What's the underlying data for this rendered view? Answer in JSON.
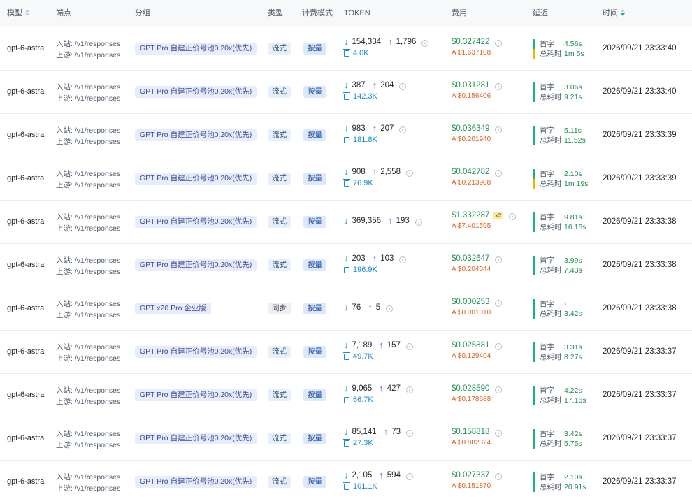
{
  "header": {
    "model": "模型",
    "endpoint": "端点",
    "group": "分组",
    "type": "类型",
    "billing": "计费模式",
    "token": "TOKEN",
    "fee": "费用",
    "latency": "延迟",
    "time": "时间"
  },
  "labels": {
    "first_token": "首字",
    "total_time": "总耗时"
  },
  "colors": {
    "fee_green": "#1f8f4e",
    "fee_alt_orange": "#e0601c",
    "cache_blue": "#1a8ad0",
    "latency_green": "#18b17a",
    "latency_yellow": "#f0b400",
    "group_bg": "#e8edfb",
    "sort_active": "#14a89b"
  },
  "icons": {
    "in": "arrow-down-icon",
    "out": "arrow-up-icon",
    "cache": "cache-icon",
    "info": "info-icon",
    "sort": "sort-icon"
  },
  "rows": [
    {
      "model": "gpt-6-astra",
      "in_ep": "入站: /v1/responses",
      "up_ep": "上游: /v1/responses",
      "group": "GPT Pro 自建正价号池0.20x(优先)",
      "type": "流式",
      "billing": "按量",
      "in_tok": "154,334",
      "out_tok": "1,796",
      "cache": "4.0K",
      "fee": "$0.327422",
      "mult": "",
      "fee_alt": "A $1.637108",
      "first": "4.56s",
      "total": "1m 5s",
      "slow": true,
      "time": "2026/09/21 23:33:40"
    },
    {
      "model": "gpt-6-astra",
      "in_ep": "入站: /v1/responses",
      "up_ep": "上游: /v1/responses",
      "group": "GPT Pro 自建正价号池0.20x(优先)",
      "type": "流式",
      "billing": "按量",
      "in_tok": "387",
      "out_tok": "204",
      "cache": "142.3K",
      "fee": "$0.031281",
      "mult": "",
      "fee_alt": "A $0.156406",
      "first": "3.06s",
      "total": "9.21s",
      "slow": false,
      "time": "2026/09/21 23:33:40"
    },
    {
      "model": "gpt-6-astra",
      "in_ep": "入站: /v1/responses",
      "up_ep": "上游: /v1/responses",
      "group": "GPT Pro 自建正价号池0.20x(优先)",
      "type": "流式",
      "billing": "按量",
      "in_tok": "983",
      "out_tok": "207",
      "cache": "181.8K",
      "fee": "$0.036349",
      "mult": "",
      "fee_alt": "A $0.201940",
      "first": "5.11s",
      "total": "11.52s",
      "slow": false,
      "time": "2026/09/21 23:33:39"
    },
    {
      "model": "gpt-6-astra",
      "in_ep": "入站: /v1/responses",
      "up_ep": "上游: /v1/responses",
      "group": "GPT Pro 自建正价号池0.20x(优先)",
      "type": "流式",
      "billing": "按量",
      "in_tok": "908",
      "out_tok": "2,558",
      "cache": "76.9K",
      "fee": "$0.042782",
      "mult": "",
      "fee_alt": "A $0.213908",
      "first": "2.10s",
      "total": "1m 19s",
      "slow": true,
      "time": "2026/09/21 23:33:39"
    },
    {
      "model": "gpt-6-astra",
      "in_ep": "入站: /v1/responses",
      "up_ep": "上游: /v1/responses",
      "group": "GPT Pro 自建正价号池0.20x(优先)",
      "type": "流式",
      "billing": "按量",
      "in_tok": "369,356",
      "out_tok": "193",
      "cache": "",
      "fee": "$1.332287",
      "mult": "x2",
      "fee_alt": "A $7.401595",
      "first": "9.81s",
      "total": "16.16s",
      "slow": false,
      "time": "2026/09/21 23:33:38"
    },
    {
      "model": "gpt-6-astra",
      "in_ep": "入站: /v1/responses",
      "up_ep": "上游: /v1/responses",
      "group": "GPT Pro 自建正价号池0.20x(优先)",
      "type": "流式",
      "billing": "按量",
      "in_tok": "203",
      "out_tok": "103",
      "cache": "196.9K",
      "fee": "$0.032647",
      "mult": "",
      "fee_alt": "A $0.204044",
      "first": "3.99s",
      "total": "7.43s",
      "slow": false,
      "time": "2026/09/21 23:33:38"
    },
    {
      "model": "gpt-6-astra",
      "in_ep": "入站: /v1/responses",
      "up_ep": "上游: /v1/responses",
      "group": "GPT x20 Pro 企业版",
      "type": "同步",
      "billing": "按量",
      "in_tok": "76",
      "out_tok": "5",
      "cache": "",
      "fee": "$0.000253",
      "mult": "",
      "fee_alt": "A $0.001010",
      "first": "-",
      "total": "3.42s",
      "slow": false,
      "time": "2026/09/21 23:33:38"
    },
    {
      "model": "gpt-6-astra",
      "in_ep": "入站: /v1/responses",
      "up_ep": "上游: /v1/responses",
      "group": "GPT Pro 自建正价号池0.20x(优先)",
      "type": "流式",
      "billing": "按量",
      "in_tok": "7,189",
      "out_tok": "157",
      "cache": "49.7K",
      "fee": "$0.025881",
      "mult": "",
      "fee_alt": "A $0.129404",
      "first": "3.31s",
      "total": "8.27s",
      "slow": false,
      "time": "2026/09/21 23:33:37"
    },
    {
      "model": "gpt-6-astra",
      "in_ep": "入站: /v1/responses",
      "up_ep": "上游: /v1/responses",
      "group": "GPT Pro 自建正价号池0.20x(优先)",
      "type": "流式",
      "billing": "按量",
      "in_tok": "9,065",
      "out_tok": "427",
      "cache": "66.7K",
      "fee": "$0.028590",
      "mult": "",
      "fee_alt": "A $0.178688",
      "first": "4.22s",
      "total": "17.16s",
      "slow": false,
      "time": "2026/09/21 23:33:37"
    },
    {
      "model": "gpt-6-astra",
      "in_ep": "入站: /v1/responses",
      "up_ep": "上游: /v1/responses",
      "group": "GPT Pro 自建正价号池0.20x(优先)",
      "type": "流式",
      "billing": "按量",
      "in_tok": "85,141",
      "out_tok": "73",
      "cache": "27.3K",
      "fee": "$0.158818",
      "mult": "",
      "fee_alt": "A $0.882324",
      "first": "3.42s",
      "total": "5.75s",
      "slow": false,
      "time": "2026/09/21 23:33:37"
    },
    {
      "model": "gpt-6-astra",
      "in_ep": "入站: /v1/responses",
      "up_ep": "上游: /v1/responses",
      "group": "GPT Pro 自建正价号池0.20x(优先)",
      "type": "流式",
      "billing": "按量",
      "in_tok": "2,105",
      "out_tok": "594",
      "cache": "101.1K",
      "fee": "$0.027337",
      "mult": "",
      "fee_alt": "A $0.151870",
      "first": "2.10s",
      "total": "20.91s",
      "slow": false,
      "time": "2026/09/21 23:33:37"
    }
  ]
}
